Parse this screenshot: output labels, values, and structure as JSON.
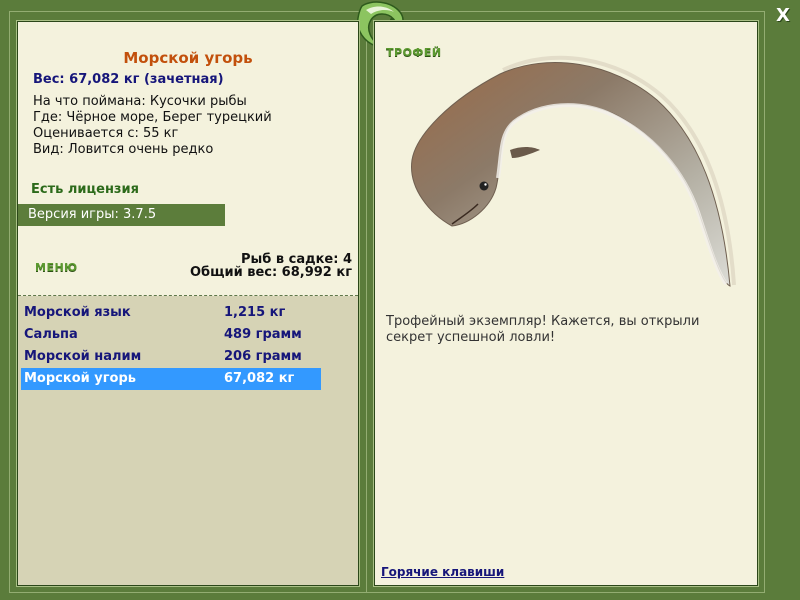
{
  "window": {
    "close_label": "X"
  },
  "logo": {
    "icon": "game-logo-icon"
  },
  "colors": {
    "frame": "#5b7c3b",
    "panel": "#f4f2dd",
    "list_background": "#d6d3b5",
    "fish_title": "#c2500c",
    "text_navy": "#16167a",
    "license_green": "#2c6a1a",
    "selection": "#3399ff",
    "version_bar": "#5c7d3b"
  },
  "fish_info": {
    "name": "Морской угорь",
    "weight_line": "Вес: 67,082 кг (зачетная)",
    "details": [
      "На что поймана: Кусочки рыбы",
      "Где: Чёрное море, Берег турецкий",
      "Оценивается с: 55 кг",
      "Вид: Ловится очень редко"
    ],
    "license": "Есть лицензия"
  },
  "version": "Версия игры: 3.7.5",
  "menu": {
    "label": "МЕНЮ",
    "keepnet_count": "Рыб в садке: 4",
    "total_weight": "Общий вес: 68,992 кг"
  },
  "catch_list": {
    "selected_index": 3,
    "items": [
      {
        "name": "Морской язык",
        "weight": "1,215 кг"
      },
      {
        "name": "Сальпа",
        "weight": "489 грамм"
      },
      {
        "name": "Морской налим",
        "weight": "206 грамм"
      },
      {
        "name": "Морской угорь",
        "weight": "67,082 кг"
      }
    ]
  },
  "trophy": {
    "label": "ТРОФЕЙ",
    "image_icon": "conger-eel-image",
    "description": "Трофейный экземпляр! Кажется, вы открыли секрет успешной ловли!"
  },
  "hotkeys_link": "Горячие клавиши"
}
